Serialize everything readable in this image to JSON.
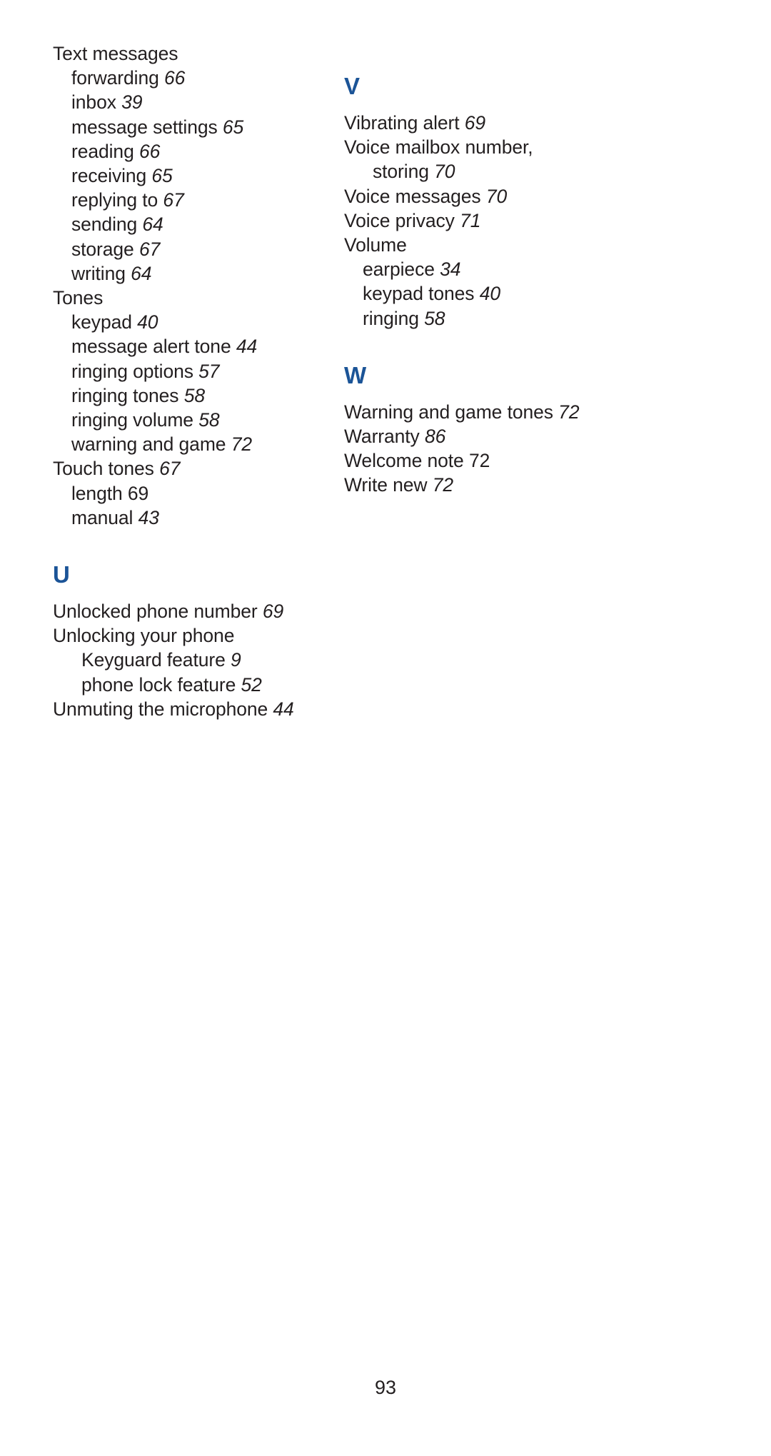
{
  "page": {
    "folio": "93",
    "accent_color": "#1b5497",
    "text_color": "#231f20",
    "background": "#ffffff"
  },
  "left_column": {
    "groups": [
      {
        "heading": null,
        "entries": [
          {
            "label": "Text messages",
            "page": "",
            "level": 0,
            "italic": false
          },
          {
            "label": "forwarding",
            "page": "66",
            "level": 1,
            "italic": true
          },
          {
            "label": "inbox",
            "page": "39",
            "level": 1,
            "italic": true
          },
          {
            "label": "message settings",
            "page": "65",
            "level": 1,
            "italic": true
          },
          {
            "label": "reading",
            "page": "66",
            "level": 1,
            "italic": true
          },
          {
            "label": "receiving",
            "page": "65",
            "level": 1,
            "italic": true
          },
          {
            "label": "replying to",
            "page": "67",
            "level": 1,
            "italic": true
          },
          {
            "label": "sending",
            "page": "64",
            "level": 1,
            "italic": true
          },
          {
            "label": "storage",
            "page": "67",
            "level": 1,
            "italic": true
          },
          {
            "label": "writing",
            "page": "64",
            "level": 1,
            "italic": true
          },
          {
            "label": "Tones",
            "page": "",
            "level": 0,
            "italic": false
          },
          {
            "label": "keypad",
            "page": "40",
            "level": 1,
            "italic": true
          },
          {
            "label": "message alert tone",
            "page": "44",
            "level": 1,
            "italic": true
          },
          {
            "label": "ringing options",
            "page": "57",
            "level": 1,
            "italic": true
          },
          {
            "label": "ringing tones",
            "page": "58",
            "level": 1,
            "italic": true
          },
          {
            "label": "ringing volume",
            "page": "58",
            "level": 1,
            "italic": true
          },
          {
            "label": "warning and game",
            "page": "72",
            "level": 1,
            "italic": true
          },
          {
            "label": "Touch tones",
            "page": "67",
            "level": 0,
            "italic": true
          },
          {
            "label": "length",
            "page": "69",
            "level": 1,
            "italic": false
          },
          {
            "label": "manual",
            "page": "43",
            "level": 1,
            "italic": true
          }
        ]
      },
      {
        "heading": "U",
        "entries": [
          {
            "label": "Unlocked phone number",
            "page": "69",
            "level": 0,
            "italic": true
          },
          {
            "label": "Unlocking your phone",
            "page": "",
            "level": 0,
            "italic": false
          },
          {
            "label": "Keyguard feature",
            "page": "9",
            "level": 2,
            "italic": true
          },
          {
            "label": "phone lock feature",
            "page": "52",
            "level": 2,
            "italic": true
          },
          {
            "label": "Unmuting the microphone",
            "page": "44",
            "level": 0,
            "italic": true
          }
        ]
      }
    ]
  },
  "right_column": {
    "groups": [
      {
        "heading": "V",
        "entries": [
          {
            "label": "Vibrating alert",
            "page": "69",
            "level": 0,
            "italic": true
          },
          {
            "label": "Voice mailbox number,",
            "page": "",
            "level": 0,
            "italic": false
          },
          {
            "label": "storing",
            "page": "70",
            "level": 2,
            "italic": true
          },
          {
            "label": "Voice messages",
            "page": "70",
            "level": 0,
            "italic": true
          },
          {
            "label": "Voice privacy",
            "page": "71",
            "level": 0,
            "italic": true
          },
          {
            "label": "Volume",
            "page": "",
            "level": 0,
            "italic": false
          },
          {
            "label": "earpiece",
            "page": "34",
            "level": 1,
            "italic": true
          },
          {
            "label": "keypad tones",
            "page": "40",
            "level": 1,
            "italic": true
          },
          {
            "label": "ringing",
            "page": "58",
            "level": 1,
            "italic": true
          }
        ]
      },
      {
        "heading": "W",
        "entries": [
          {
            "label": "Warning and game tones",
            "page": "72",
            "level": 0,
            "italic": true
          },
          {
            "label": "Warranty",
            "page": "86",
            "level": 0,
            "italic": true
          },
          {
            "label": "Welcome note",
            "page": "72",
            "level": 0,
            "italic": false
          },
          {
            "label": "Write new",
            "page": "72",
            "level": 0,
            "italic": true
          }
        ]
      }
    ]
  }
}
